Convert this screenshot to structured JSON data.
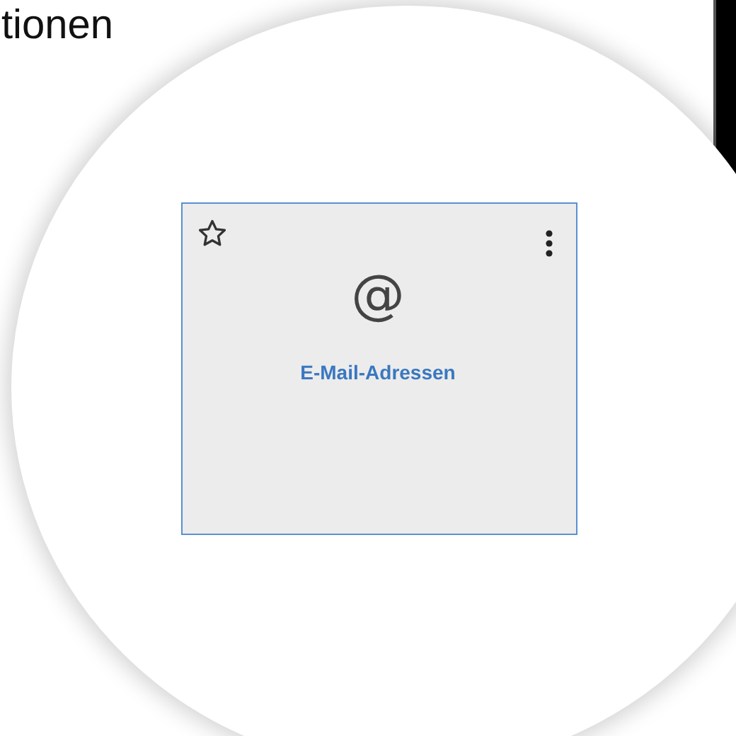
{
  "heading": "tionen",
  "tile": {
    "favorite": false,
    "symbol": "@",
    "label": "E-Mail-Adressen"
  }
}
